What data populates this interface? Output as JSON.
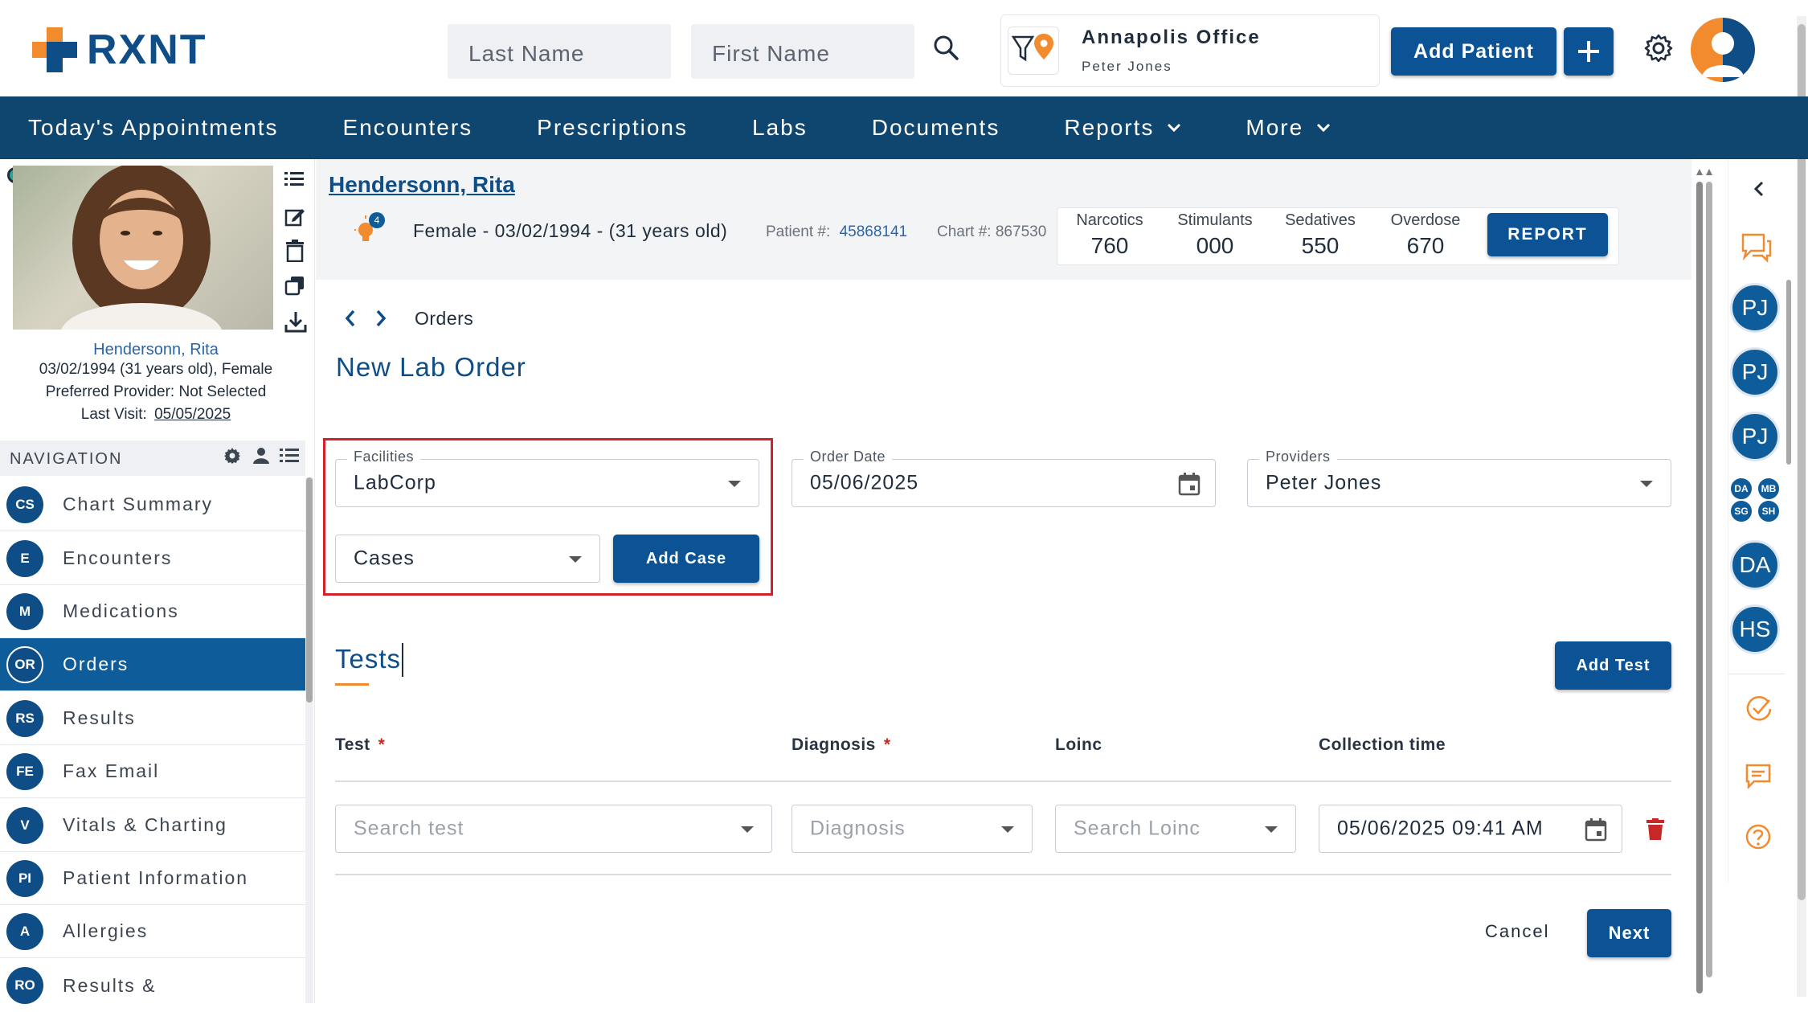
{
  "header": {
    "brand": "RXNT",
    "last_name_placeholder": "Last Name",
    "first_name_placeholder": "First Name",
    "office_name": "Annapolis Office",
    "office_user": "Peter Jones",
    "add_patient_label": "Add Patient"
  },
  "nav": {
    "items": [
      {
        "label": "Today's Appointments"
      },
      {
        "label": "Encounters"
      },
      {
        "label": "Prescriptions"
      },
      {
        "label": "Labs"
      },
      {
        "label": "Documents"
      },
      {
        "label": "Reports"
      },
      {
        "label": "More"
      }
    ]
  },
  "patient_card": {
    "name": "Hendersonn, Rita",
    "dob_line": "03/02/1994 (31 years old), Female",
    "preferred_provider": "Preferred Provider: Not Selected",
    "last_visit_label": "Last Visit:",
    "last_visit_date": "05/05/2025"
  },
  "sidebar": {
    "title": "NAVIGATION",
    "items": [
      {
        "abbr": "CS",
        "label": "Chart Summary"
      },
      {
        "abbr": "E",
        "label": "Encounters"
      },
      {
        "abbr": "M",
        "label": "Medications"
      },
      {
        "abbr": "OR",
        "label": "Orders"
      },
      {
        "abbr": "RS",
        "label": "Results"
      },
      {
        "abbr": "FE",
        "label": "Fax Email"
      },
      {
        "abbr": "V",
        "label": "Vitals & Charting"
      },
      {
        "abbr": "PI",
        "label": "Patient Information"
      },
      {
        "abbr": "A",
        "label": "Allergies"
      },
      {
        "abbr": "RO",
        "label": "Results &"
      }
    ],
    "active_index": 3
  },
  "patient_header": {
    "name": "Hendersonn, Rita",
    "alert_count": "4",
    "demographics": "Female - 03/02/1994 - (31 years old)",
    "patient_num_label": "Patient #:",
    "patient_num": "45868141",
    "chart_label": "Chart #: 867530",
    "stats": [
      {
        "label": "Narcotics",
        "value": "760"
      },
      {
        "label": "Stimulants",
        "value": "000"
      },
      {
        "label": "Sedatives",
        "value": "550"
      },
      {
        "label": "Overdose",
        "value": "670"
      }
    ],
    "report_label": "REPORT"
  },
  "breadcrumb": {
    "label": "Orders"
  },
  "page_title": "New Lab Order",
  "form": {
    "facilities_label": "Facilities",
    "facilities_value": "LabCorp",
    "order_date_label": "Order Date",
    "order_date_value": "05/06/2025",
    "providers_label": "Providers",
    "providers_value": "Peter Jones",
    "cases_placeholder": "Cases",
    "add_case_label": "Add Case"
  },
  "tests": {
    "title": "Tests",
    "add_test_label": "Add Test",
    "columns": {
      "test": "Test",
      "diagnosis": "Diagnosis",
      "loinc": "Loinc",
      "collection": "Collection time"
    },
    "required_mark": "*",
    "row": {
      "test_placeholder": "Search test",
      "diagnosis_placeholder": "Diagnosis",
      "loinc_placeholder": "Search Loinc",
      "collection_value": "05/06/2025 09:41 AM"
    }
  },
  "footer": {
    "cancel_label": "Cancel",
    "next_label": "Next"
  },
  "right_rail": {
    "badges": [
      "PJ",
      "PJ",
      "PJ"
    ],
    "mini": [
      "DA",
      "MB",
      "SG",
      "SH"
    ],
    "badges2": [
      "DA",
      "HS"
    ]
  },
  "colors": {
    "primary": "#0b5394",
    "navbar": "#0e4670",
    "accent_orange": "#f28a2e",
    "highlight_red": "#d4202a"
  }
}
